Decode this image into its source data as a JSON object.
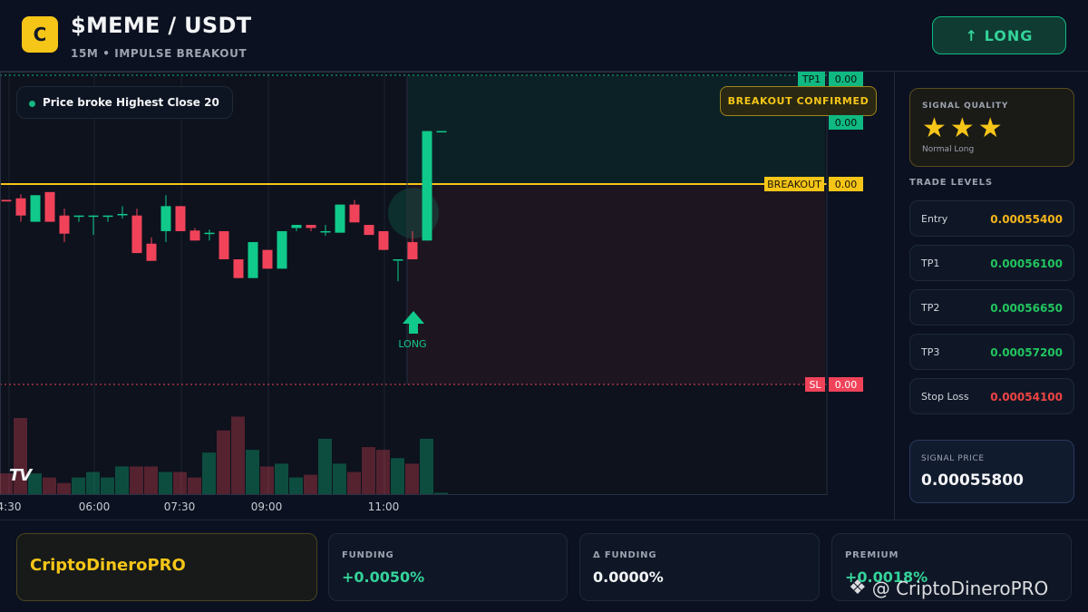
{
  "header": {
    "logo_letter": "C",
    "pair": "$MEME / USDT",
    "subtitle": "15M • IMPULSE BREAKOUT",
    "direction_button": "↑ LONG"
  },
  "chart": {
    "signal_note": "Price broke Highest Close 20",
    "breakout_badge": "BREAKOUT CONFIRMED",
    "long_marker": "LONG",
    "tv_logo": "TV",
    "time_ticks": [
      "4:30",
      "06:00",
      "07:30",
      "09:00",
      "11:00"
    ],
    "labels": {
      "tp1": "TP1",
      "tp1_value": "0.00",
      "last_value": "0.00",
      "breakout": "BREAKOUT",
      "breakout_value": "0.00",
      "sl": "SL",
      "sl_value": "0.00"
    },
    "candles": [
      {
        "o": 0.59,
        "h": 0.59,
        "l": 0.585,
        "c": 0.585
      },
      {
        "o": 0.595,
        "h": 0.608,
        "l": 0.52,
        "c": 0.54
      },
      {
        "o": 0.52,
        "h": 0.605,
        "l": 0.52,
        "c": 0.605
      },
      {
        "o": 0.615,
        "h": 0.615,
        "l": 0.52,
        "c": 0.52
      },
      {
        "o": 0.54,
        "h": 0.562,
        "l": 0.455,
        "c": 0.482
      },
      {
        "o": 0.54,
        "h": 0.54,
        "l": 0.52,
        "c": 0.54
      },
      {
        "o": 0.54,
        "h": 0.54,
        "l": 0.478,
        "c": 0.54
      },
      {
        "o": 0.54,
        "h": 0.54,
        "l": 0.52,
        "c": 0.54
      },
      {
        "o": 0.545,
        "h": 0.57,
        "l": 0.53,
        "c": 0.545
      },
      {
        "o": 0.54,
        "h": 0.562,
        "l": 0.42,
        "c": 0.42
      },
      {
        "o": 0.45,
        "h": 0.47,
        "l": 0.395,
        "c": 0.395
      },
      {
        "o": 0.49,
        "h": 0.605,
        "l": 0.455,
        "c": 0.57
      },
      {
        "o": 0.57,
        "h": 0.57,
        "l": 0.49,
        "c": 0.49
      },
      {
        "o": 0.492,
        "h": 0.5,
        "l": 0.46,
        "c": 0.46
      },
      {
        "o": 0.485,
        "h": 0.495,
        "l": 0.46,
        "c": 0.485
      },
      {
        "o": 0.49,
        "h": 0.49,
        "l": 0.4,
        "c": 0.4
      },
      {
        "o": 0.4,
        "h": 0.4,
        "l": 0.34,
        "c": 0.34
      },
      {
        "o": 0.34,
        "h": 0.455,
        "l": 0.34,
        "c": 0.455
      },
      {
        "o": 0.43,
        "h": 0.43,
        "l": 0.37,
        "c": 0.37
      },
      {
        "o": 0.37,
        "h": 0.49,
        "l": 0.37,
        "c": 0.49
      },
      {
        "o": 0.5,
        "h": 0.51,
        "l": 0.49,
        "c": 0.51
      },
      {
        "o": 0.51,
        "h": 0.51,
        "l": 0.49,
        "c": 0.5
      },
      {
        "o": 0.49,
        "h": 0.51,
        "l": 0.475,
        "c": 0.49
      },
      {
        "o": 0.485,
        "h": 0.575,
        "l": 0.485,
        "c": 0.575
      },
      {
        "o": 0.575,
        "h": 0.59,
        "l": 0.518,
        "c": 0.518
      },
      {
        "o": 0.51,
        "h": 0.51,
        "l": 0.478,
        "c": 0.478
      },
      {
        "o": 0.49,
        "h": 0.49,
        "l": 0.43,
        "c": 0.43
      },
      {
        "o": 0.4,
        "h": 0.4,
        "l": 0.33,
        "c": 0.4
      },
      {
        "o": 0.455,
        "h": 0.49,
        "l": 0.4,
        "c": 0.4
      },
      {
        "o": 0.46,
        "h": 0.81,
        "l": 0.46,
        "c": 0.81
      },
      {
        "o": 0.81,
        "h": 0.81,
        "l": 0.81,
        "c": 0.81
      }
    ],
    "volumes": [
      0.15,
      0.55,
      0.15,
      0.12,
      0.08,
      0.12,
      0.16,
      0.12,
      0.2,
      0.2,
      0.2,
      0.16,
      0.16,
      0.12,
      0.3,
      0.46,
      0.56,
      0.32,
      0.2,
      0.22,
      0.12,
      0.14,
      0.4,
      0.22,
      0.16,
      0.34,
      0.32,
      0.26,
      0.22,
      0.4,
      0.01
    ]
  },
  "sidebar": {
    "signal_quality_title": "SIGNAL QUALITY",
    "stars": "★★★",
    "rating_count": 3,
    "quality_label": "Normal Long",
    "trade_levels_title": "TRADE LEVELS",
    "levels": [
      {
        "name": "Entry",
        "value": "0.00055400",
        "color": "#f5b51b"
      },
      {
        "name": "TP1",
        "value": "0.00056100",
        "color": "#22c55e"
      },
      {
        "name": "TP2",
        "value": "0.00056650",
        "color": "#22c55e"
      },
      {
        "name": "TP3",
        "value": "0.00057200",
        "color": "#22c55e"
      },
      {
        "name": "Stop Loss",
        "value": "0.00054100",
        "color": "#ef4444"
      }
    ],
    "signal_price_title": "SIGNAL PRICE",
    "signal_price": "0.00055800"
  },
  "footer": {
    "brand": "CriptoDineroPRO",
    "stats": [
      {
        "label": "FUNDING",
        "value": "+0.0050%",
        "color": "#34d399"
      },
      {
        "label": "Δ FUNDING",
        "value": "0.0000%",
        "color": "#f3f4f6"
      },
      {
        "label": "PREMIUM",
        "value": "+0.0018%",
        "color": "#34d399"
      }
    ],
    "watermark": "@ CriptoDineroPRO"
  },
  "colors": {
    "bull": "#10c98a",
    "bear": "#f0435a",
    "gold": "#f5c518",
    "bg": "#0b1120"
  }
}
